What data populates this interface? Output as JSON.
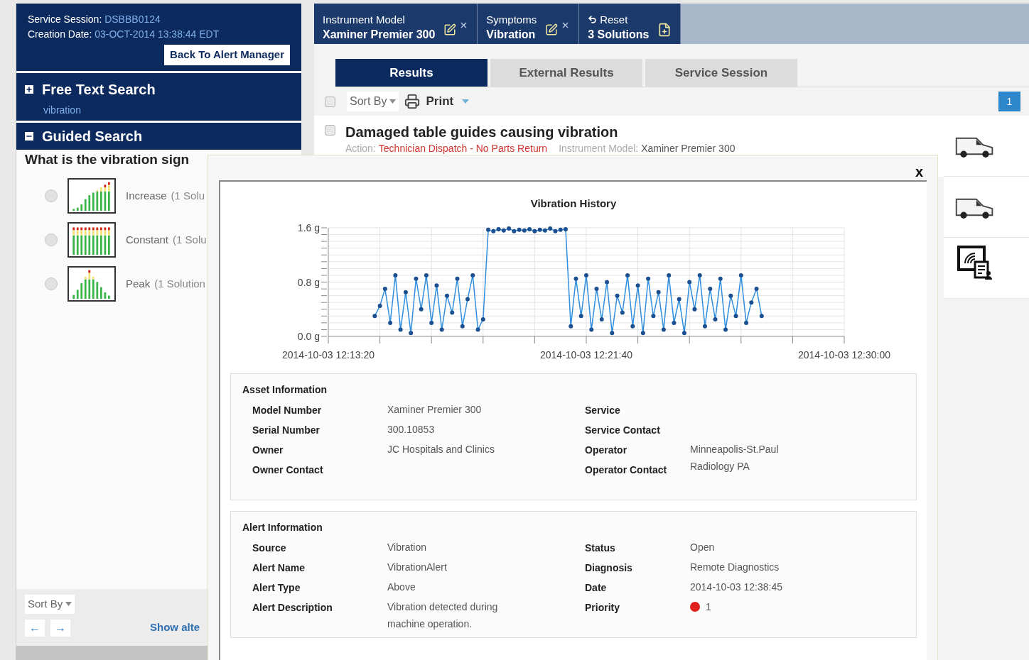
{
  "session": {
    "id_label": "Service Session:",
    "id": "DSBBB0124",
    "date_label": "Creation Date:",
    "date": "03-OCT-2014 13:38:44 EDT",
    "back_button": "Back To Alert Manager"
  },
  "free_text_search": {
    "title": "Free Text Search",
    "expanded": false,
    "query": "vibration"
  },
  "guided_search": {
    "title": "Guided Search",
    "expanded": true,
    "question": "What is the vibration sign",
    "options": [
      {
        "kind": "increase",
        "label": "Increase",
        "count": "(1 Solu",
        "selected": false
      },
      {
        "kind": "constant",
        "label": "Constant",
        "count": "(1 Solu",
        "selected": false
      },
      {
        "kind": "peak",
        "label": "Peak",
        "count": "(1 Solution",
        "selected": false
      }
    ]
  },
  "left_footer": {
    "sort_by": "Sort By",
    "prev": "←",
    "next": "→",
    "link": "Show alte"
  },
  "breadcrumbs": [
    {
      "kind": "filter",
      "label": "Instrument Model",
      "value": "Xaminer Premier 300"
    },
    {
      "kind": "filter",
      "label": "Symptoms",
      "value": "Vibration"
    },
    {
      "kind": "summary",
      "label": "Reset",
      "value": "3 Solutions"
    }
  ],
  "tabs": [
    {
      "label": "Results",
      "selected": true
    },
    {
      "label": "External Results",
      "selected": false
    },
    {
      "label": "Service Session",
      "selected": false
    }
  ],
  "toolbar": {
    "checked": false,
    "sort_by": "Sort By",
    "print": "Print",
    "page": "1"
  },
  "results": [
    {
      "checked": false,
      "title": "Damaged table guides causing vibration",
      "action_label": "Action:",
      "action": "Technician Dispatch - No Parts Return",
      "model_label": "Instrument Model:",
      "model": "Xaminer Premier 300"
    }
  ],
  "modal": {
    "close": "x",
    "chart_data": {
      "type": "line",
      "title": "Vibration History",
      "grid": true,
      "ylim": [
        0,
        1.6
      ],
      "yticks": [
        {
          "value": 0,
          "label": "0.0 g"
        },
        {
          "value": 0.8,
          "label": "0.8 g"
        },
        {
          "value": 1.6,
          "label": "1.6 g"
        }
      ],
      "categories": [
        "2014-10-03 12:13:20",
        null,
        null,
        null,
        null,
        null,
        null,
        null,
        null,
        null,
        null,
        null,
        null,
        null,
        null,
        null,
        null,
        null,
        null,
        null,
        null,
        null,
        null,
        null,
        null,
        null,
        null,
        null,
        null,
        null,
        null,
        null,
        null,
        null,
        null,
        null,
        null,
        null,
        null,
        null,
        null,
        null,
        null,
        null,
        null,
        null,
        null,
        null,
        null,
        null,
        "2014-10-03 12:21:40",
        null,
        null,
        null,
        null,
        null,
        null,
        null,
        null,
        null,
        null,
        null,
        null,
        null,
        null,
        null,
        null,
        null,
        null,
        null,
        null,
        null,
        null,
        null,
        null,
        null,
        null,
        null,
        null,
        null,
        null,
        null,
        null,
        null,
        null,
        null,
        null,
        null,
        null,
        null,
        null,
        null,
        null,
        null,
        null,
        null,
        null,
        null,
        null,
        null,
        "2014-10-03 12:30:00"
      ],
      "series": [
        {
          "color": "#2f8ee0",
          "marker": true,
          "values": [
            null,
            null,
            null,
            null,
            null,
            null,
            null,
            null,
            null,
            0.3,
            0.45,
            0.7,
            0.2,
            0.9,
            0.1,
            0.65,
            0.05,
            0.85,
            0.4,
            0.9,
            0.2,
            0.75,
            0.1,
            0.6,
            0.35,
            0.85,
            0.15,
            0.55,
            0.9,
            0.1,
            0.25,
            1.57,
            1.55,
            1.58,
            1.56,
            1.59,
            1.55,
            1.57,
            1.56,
            1.58,
            1.55,
            1.57,
            1.56,
            1.59,
            1.55,
            1.57,
            1.58,
            0.15,
            0.85,
            0.3,
            0.9,
            0.1,
            0.7,
            0.25,
            0.8,
            0.05,
            0.6,
            0.35,
            0.9,
            0.15,
            0.75,
            0.05,
            0.85,
            0.3,
            0.65,
            0.1,
            0.9,
            0.2,
            0.55,
            0.05,
            0.8,
            0.4,
            0.9,
            0.15,
            0.7,
            0.25,
            0.85,
            0.1,
            0.6,
            0.3,
            0.9,
            0.2,
            0.5,
            0.7,
            0.3,
            null,
            null,
            null,
            null,
            null,
            null,
            null,
            null,
            null,
            null,
            null,
            null,
            null,
            null,
            null,
            null
          ]
        }
      ]
    },
    "sections": [
      {
        "title": "Asset Information",
        "left": [
          {
            "label": "Model Number",
            "value": "Xaminer Premier 300"
          },
          {
            "label": "Serial Number",
            "value": "300.10853"
          },
          {
            "label": "Owner",
            "value": "JC Hospitals and Clinics"
          },
          {
            "label": "Owner Contact"
          }
        ],
        "right": [
          {
            "label": "Service"
          },
          {
            "label": "Service Contact"
          },
          {
            "label": "Operator",
            "value": "Minneapolis-St.Paul Radiology PA"
          },
          {
            "label": "Operator Contact"
          }
        ]
      },
      {
        "title": "Alert Information",
        "left": [
          {
            "label": "Source",
            "value": "Vibration"
          },
          {
            "label": "Alert Name",
            "value": "VibrationAlert"
          },
          {
            "label": "Alert Type",
            "value": "Above"
          },
          {
            "label": "Alert Description",
            "value": "Vibration detected during machine operation."
          }
        ],
        "right": [
          {
            "label": "Status",
            "value": "Open"
          },
          {
            "label": "Diagnosis",
            "value": "Remote Diagnostics"
          },
          {
            "label": "Date",
            "value": "2014-10-03 12:38:45"
          },
          {
            "label": "Priority",
            "value": "1",
            "kind": "priority"
          }
        ]
      }
    ]
  }
}
